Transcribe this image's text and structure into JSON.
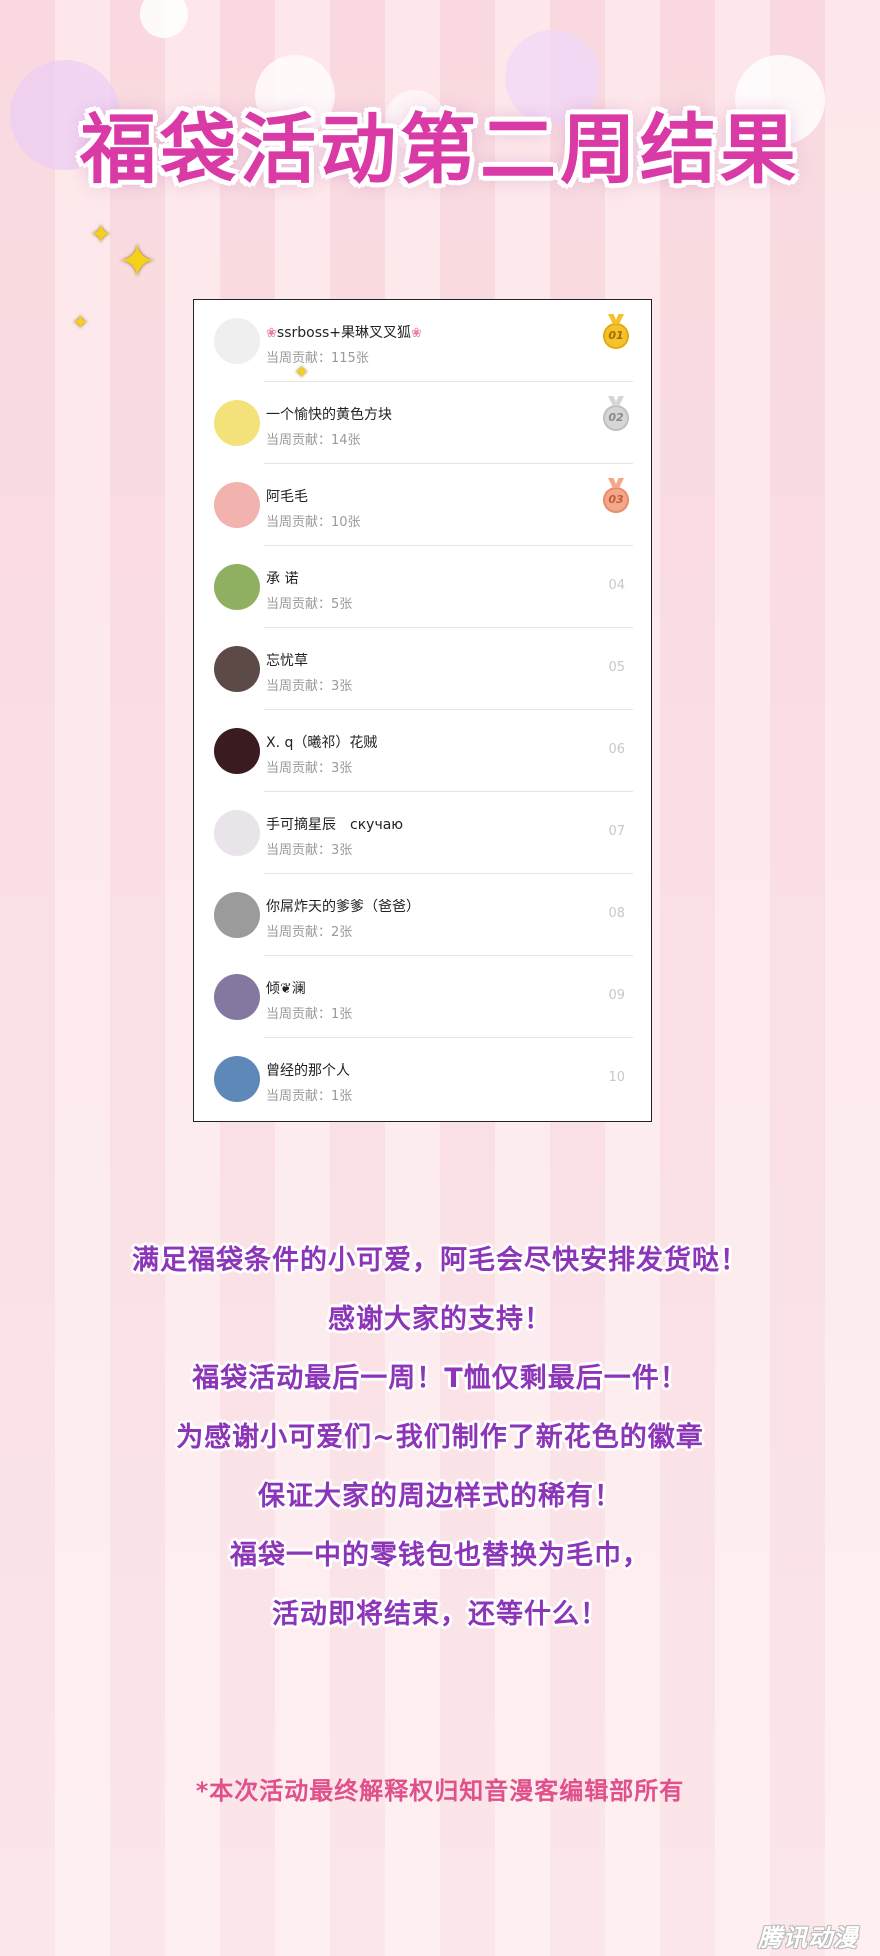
{
  "title": "福袋活动第二周结果",
  "leaderboard": {
    "contrib_prefix": "当周贡献：",
    "rows": [
      {
        "name": "ssrboss+果琳叉叉狐",
        "contribution": "当周贡献：115张",
        "rank": "01",
        "medal": "gold",
        "avatar_color": "#efefef"
      },
      {
        "name": "一个愉快的黄色方块",
        "contribution": "当周贡献：14张",
        "rank": "02",
        "medal": "silver",
        "avatar_color": "#f3e27a"
      },
      {
        "name": "阿毛毛",
        "contribution": "当周贡献：10张",
        "rank": "03",
        "medal": "bronze",
        "avatar_color": "#f2b2ae"
      },
      {
        "name": "承 诺",
        "contribution": "当周贡献：5张",
        "rank": "04",
        "medal": "",
        "avatar_color": "#8fb060"
      },
      {
        "name": "忘忧草",
        "contribution": "当周贡献：3张",
        "rank": "05",
        "medal": "",
        "avatar_color": "#5b4a45"
      },
      {
        "name": "X. q（曦祁）花贼",
        "contribution": "当周贡献：3张",
        "rank": "06",
        "medal": "",
        "avatar_color": "#3a1c20"
      },
      {
        "name": "手可摘星辰　скучаю",
        "contribution": "当周贡献：3张",
        "rank": "07",
        "medal": "",
        "avatar_color": "#e8e4ea"
      },
      {
        "name": "你屌炸天的爹爹（爸爸）",
        "contribution": "当周贡献：2张",
        "rank": "08",
        "medal": "",
        "avatar_color": "#9b9b9b"
      },
      {
        "name": "倾❦澜",
        "contribution": "当周贡献：1张",
        "rank": "09",
        "medal": "",
        "avatar_color": "#8478a0"
      },
      {
        "name": "曾经的那个人",
        "contribution": "当周贡献：1张",
        "rank": "10",
        "medal": "",
        "avatar_color": "#5e88b8"
      }
    ]
  },
  "message": {
    "lines": [
      "满足福袋条件的小可爱，阿毛会尽快安排发货哒！",
      "感谢大家的支持！",
      "福袋活动最后一周！T恤仅剩最后一件！",
      "为感谢小可爱们~我们制作了新花色的徽章",
      "保证大家的周边样式的稀有！",
      "福袋一中的零钱包也替换为毛巾，",
      "活动即将结束，还等什么！"
    ]
  },
  "disclaimer": "*本次活动最终解释权归知音漫客编辑部所有",
  "watermark": "腾讯动漫",
  "colors": {
    "title": "#d93aa6",
    "message": "#8d35b8",
    "disclaimer": "#e0508a",
    "stripe_a": "#f9d9df",
    "stripe_b": "#fde7ea"
  }
}
